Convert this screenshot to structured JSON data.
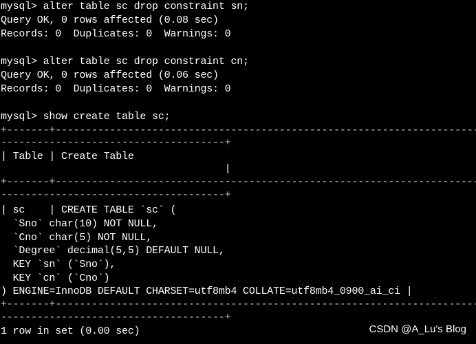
{
  "terminal": {
    "lines": [
      "mysql> alter table sc drop constraint sn;",
      "Query OK, 0 rows affected (0.08 sec)",
      "Records: 0  Duplicates: 0  Warnings: 0",
      "",
      "mysql> alter table sc drop constraint cn;",
      "Query OK, 0 rows affected (0.06 sec)",
      "Records: 0  Duplicates: 0  Warnings: 0",
      "",
      "mysql> show create table sc;",
      "+-------+---------------------------------------------------------------------------",
      "-------------------------------------+",
      "| Table | Create Table",
      "                                     |",
      "+-------+---------------------------------------------------------------------------",
      "-------------------------------------+",
      "| sc    | CREATE TABLE `sc` (",
      "  `Sno` char(10) NOT NULL,",
      "  `Cno` char(5) NOT NULL,",
      "  `Degree` decimal(5,5) DEFAULT NULL,",
      "  KEY `sn` (`Sno`),",
      "  KEY `cn` (`Cno`)",
      ") ENGINE=InnoDB DEFAULT CHARSET=utf8mb4 COLLATE=utf8mb4_0900_ai_ci |",
      "+-------+---------------------------------------------------------------------------",
      "-------------------------------------+",
      "1 row in set (0.00 sec)"
    ],
    "watermark": "CSDN @A_Lu's Blog",
    "colors": {
      "background": "#000000",
      "text": "#ffffff",
      "border": "#c8c8c8"
    }
  }
}
